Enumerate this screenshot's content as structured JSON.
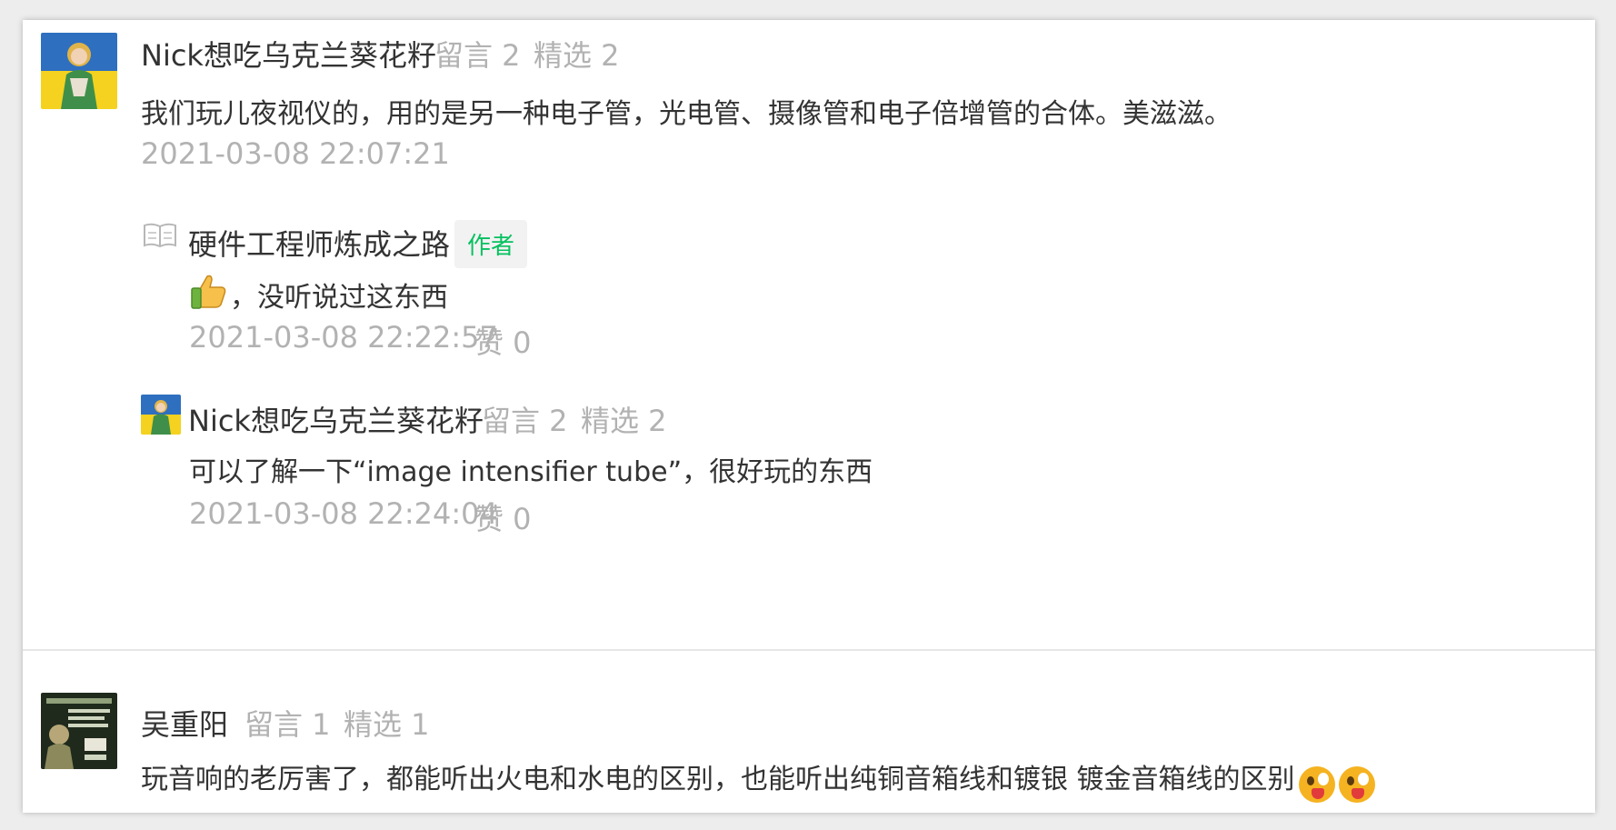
{
  "comments": [
    {
      "user": {
        "name": "Nick想吃乌克兰葵花籽",
        "messages": "留言 2",
        "featured": "精选 2"
      },
      "text": "我们玩儿夜视仪的，用的是另一种电子管，光电管、摄像管和电子倍增管的合体。美滋滋。",
      "time": "2021-03-08 22:07:21",
      "replies": [
        {
          "author": "硬件工程师炼成之路",
          "author_badge": "作者",
          "text": "，没听说过这东西",
          "time": "2021-03-08 22:22:57",
          "likes": "赞 0"
        },
        {
          "author": "Nick想吃乌克兰葵花籽",
          "messages": "留言 2",
          "featured": "精选 2",
          "text": "可以了解一下“image intensifier tube”，很好玩的东西",
          "time": "2021-03-08 22:24:04",
          "likes": "赞 0"
        }
      ]
    },
    {
      "user": {
        "name": "吴重阳",
        "messages": "留言 1",
        "featured": "精选 1"
      },
      "text": "玩音响的老厉害了，都能听出火电和水电的区别，也能听出纯铜音箱线和镀银 镀金音箱线的区别"
    }
  ],
  "icons": {
    "author_book": "book-icon",
    "reply_thumb": "thumbs-up-emoji",
    "tongue": "tongue-out-emoji"
  },
  "colors": {
    "author_badge": "#07c160",
    "meta": "#b2b2b2",
    "text": "#333333"
  }
}
